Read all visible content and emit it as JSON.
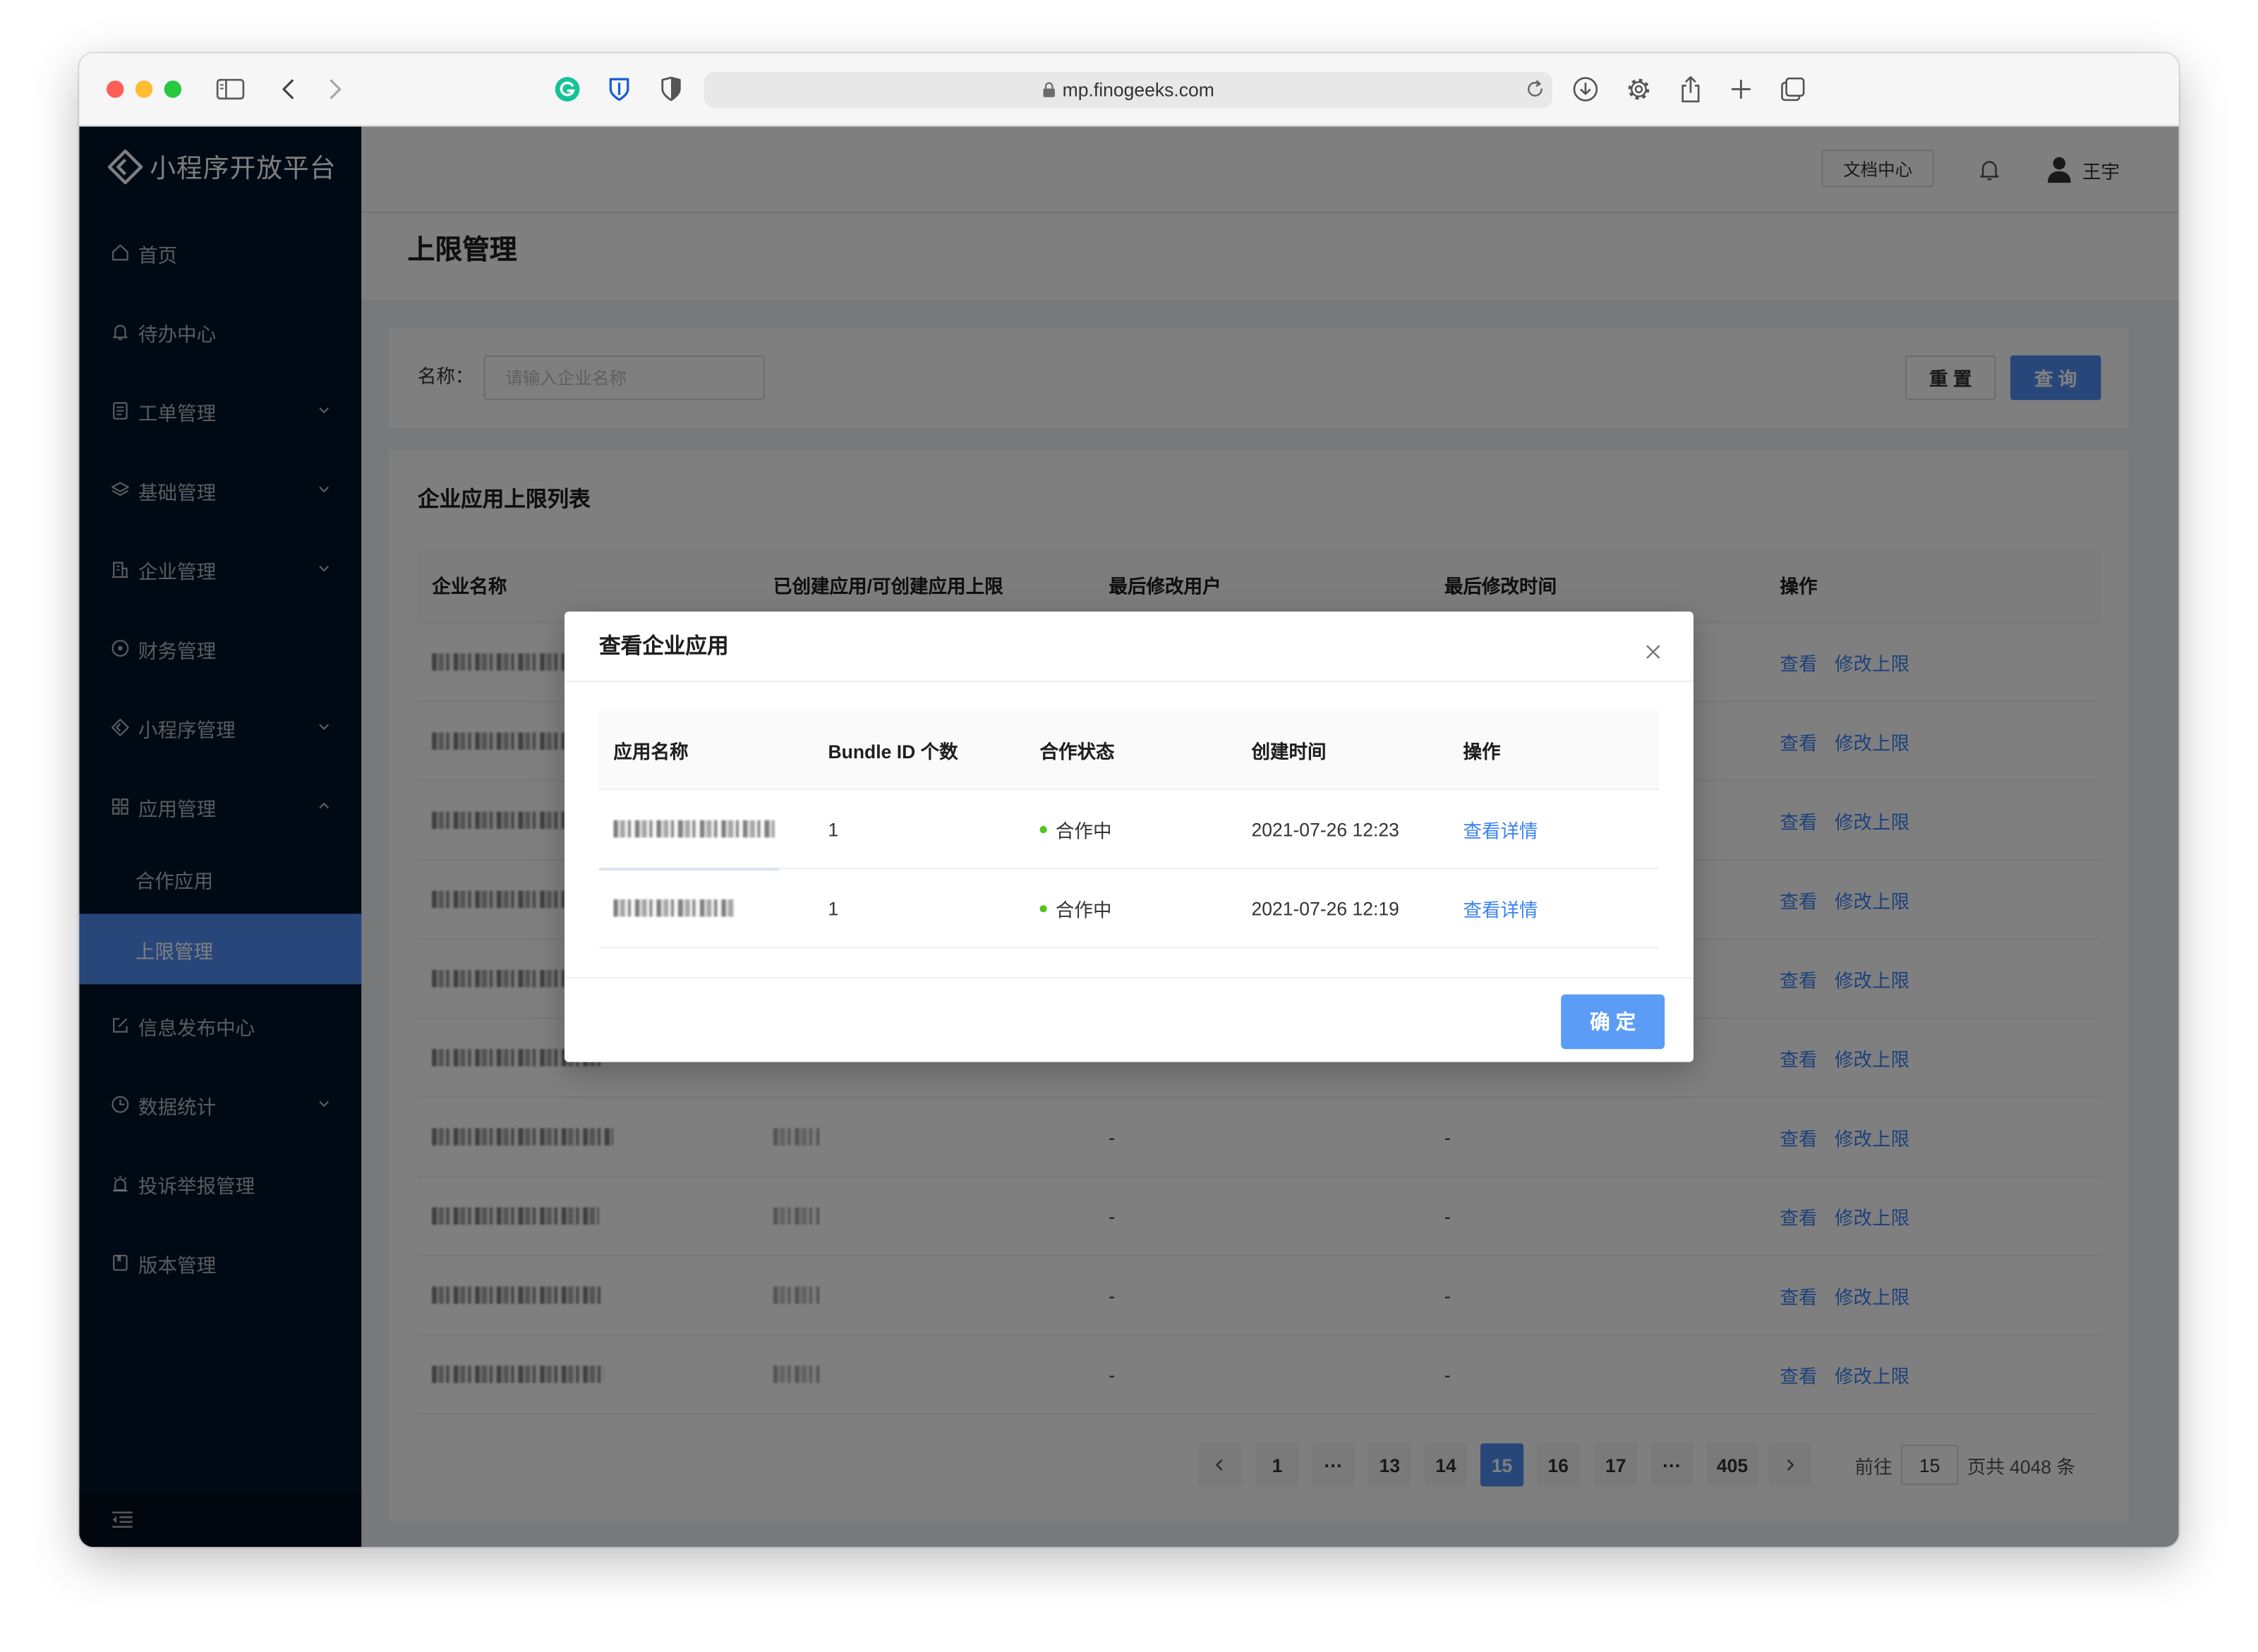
{
  "browser": {
    "url": "mp.finogeeks.com"
  },
  "sidebar": {
    "logo_text": "小程序开放平台",
    "items": [
      {
        "label": "首页",
        "icon": "home-icon"
      },
      {
        "label": "待办中心",
        "icon": "bell-icon"
      },
      {
        "label": "工单管理",
        "icon": "file-text-icon",
        "expandable": true
      },
      {
        "label": "基础管理",
        "icon": "layers-icon",
        "expandable": true
      },
      {
        "label": "企业管理",
        "icon": "building-icon",
        "expandable": true
      },
      {
        "label": "财务管理",
        "icon": "money-circle-icon"
      },
      {
        "label": "小程序管理",
        "icon": "diamond-icon",
        "expandable": true
      },
      {
        "label": "应用管理",
        "icon": "appstore-icon",
        "expandable": true,
        "expanded": true
      }
    ],
    "app_submenu": [
      {
        "label": "合作应用"
      },
      {
        "label": "上限管理",
        "active": true
      }
    ],
    "items_after": [
      {
        "label": "信息发布中心",
        "icon": "edit-icon"
      },
      {
        "label": "数据统计",
        "icon": "pie-clock-icon",
        "expandable": true
      },
      {
        "label": "投诉举报管理",
        "icon": "alarm-icon"
      },
      {
        "label": "版本管理",
        "icon": "book-icon"
      }
    ]
  },
  "header": {
    "docs_button": "文档中心",
    "user_name": "王宇"
  },
  "page": {
    "title": "上限管理"
  },
  "filter": {
    "name_label": "名称：",
    "name_placeholder": "请输入企业名称",
    "reset_label": "重 置",
    "query_label": "查 询"
  },
  "list": {
    "title": "企业应用上限列表",
    "columns": [
      "企业名称",
      "已创建应用/可创建应用上限",
      "最后修改用户",
      "最后修改时间",
      "操作"
    ],
    "rows": [
      {
        "last_user": "",
        "last_time": "",
        "view": "查看",
        "edit": "修改上限"
      },
      {
        "last_user": "",
        "last_time": "",
        "view": "查看",
        "edit": "修改上限"
      },
      {
        "last_user": "",
        "last_time": "",
        "view": "查看",
        "edit": "修改上限"
      },
      {
        "last_user": "",
        "last_time": "",
        "view": "查看",
        "edit": "修改上限"
      },
      {
        "last_user": "",
        "last_time": "",
        "view": "查看",
        "edit": "修改上限"
      },
      {
        "last_user": "",
        "last_time": "",
        "view": "查看",
        "edit": "修改上限"
      },
      {
        "last_user": "-",
        "last_time": "-",
        "view": "查看",
        "edit": "修改上限"
      },
      {
        "last_user": "-",
        "last_time": "-",
        "view": "查看",
        "edit": "修改上限"
      },
      {
        "last_user": "-",
        "last_time": "-",
        "view": "查看",
        "edit": "修改上限"
      },
      {
        "last_user": "-",
        "last_time": "-",
        "view": "查看",
        "edit": "修改上限"
      }
    ]
  },
  "pagination": {
    "pages": [
      "1",
      "···",
      "13",
      "14",
      "15",
      "16",
      "17",
      "···",
      "405"
    ],
    "current": "15",
    "goto_label": "前往",
    "goto_value": "15",
    "total_text": "页共 4048 条"
  },
  "modal": {
    "title": "查看企业应用",
    "columns": [
      "应用名称",
      "Bundle ID 个数",
      "合作状态",
      "创建时间",
      "操作"
    ],
    "rows": [
      {
        "bundle_count": "1",
        "status": "合作中",
        "created_at": "2021-07-26 12:23",
        "action": "查看详情"
      },
      {
        "bundle_count": "1",
        "status": "合作中",
        "created_at": "2021-07-26 12:19",
        "action": "查看详情"
      }
    ],
    "confirm_label": "确 定"
  },
  "colors": {
    "primary": "#4f8ef7",
    "link": "#3b82f6",
    "sidebar_bg": "#001529",
    "status_active": "#52c41a"
  }
}
